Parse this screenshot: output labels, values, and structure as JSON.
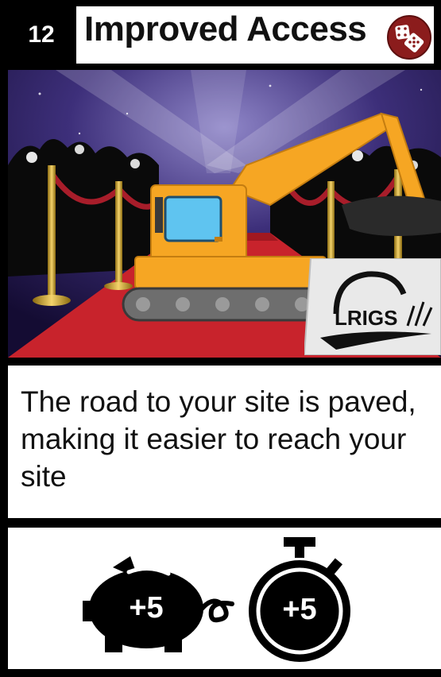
{
  "card": {
    "number": "12",
    "title": "Improved Access",
    "description": "The road to your site is paved, making it easier to reach your site",
    "logo_text": "LRIGS"
  },
  "effects": [
    {
      "icon": "piggy-bank-icon",
      "value": "+5"
    },
    {
      "icon": "stopwatch-icon",
      "value": "+5"
    }
  ],
  "colors": {
    "frame": "#000000",
    "panel": "#ffffff",
    "dice_badge": "#8b1c1c",
    "excavator": "#f6a623",
    "carpet": "#c8232c",
    "sky": "#2a1f5c"
  }
}
